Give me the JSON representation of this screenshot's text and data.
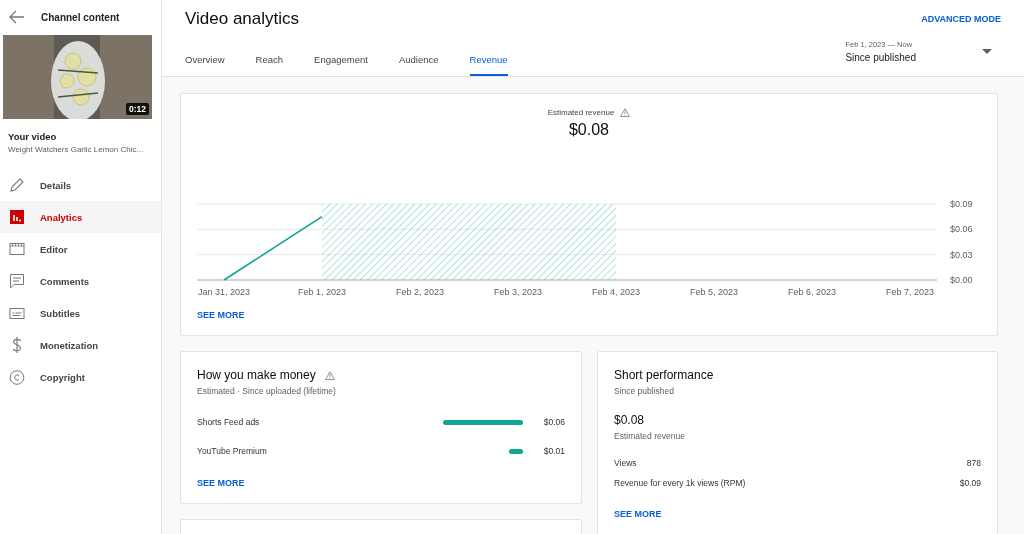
{
  "sidebar": {
    "back_label": "Channel content",
    "video": {
      "kind": "picture",
      "duration": "0:12",
      "heading": "Your video",
      "title": "Weight Watchers Garlic Lemon Chic..."
    },
    "items": [
      {
        "kind": "details",
        "label": "Details",
        "selected": false
      },
      {
        "kind": "analytics",
        "label": "Analytics",
        "selected": true
      },
      {
        "kind": "editor",
        "label": "Editor",
        "selected": false
      },
      {
        "kind": "comments",
        "label": "Comments",
        "selected": false
      },
      {
        "kind": "subtitles",
        "label": "Subtitles",
        "selected": false
      },
      {
        "kind": "monetization",
        "label": "Monetization",
        "selected": false
      },
      {
        "kind": "copyright",
        "label": "Copyright",
        "selected": false
      }
    ]
  },
  "header": {
    "title": "Video analytics",
    "advanced": "ADVANCED MODE",
    "tabs": [
      {
        "label": "Overview",
        "selected": false
      },
      {
        "label": "Reach",
        "selected": false
      },
      {
        "label": "Engagement",
        "selected": false
      },
      {
        "label": "Audience",
        "selected": false
      },
      {
        "label": "Revenue",
        "selected": true
      }
    ],
    "date_range": {
      "range": "Feb 1, 2023 — Now",
      "value": "Since published"
    }
  },
  "revenue_card": {
    "title": "Estimated revenue",
    "total": "$0.08",
    "see_more": "SEE MORE",
    "chart_data": {
      "type": "line",
      "categories": [
        "Jan 31, 2023",
        "Feb 1, 2023",
        "Feb 2, 2023",
        "Feb 3, 2023",
        "Feb 4, 2023",
        "Feb 5, 2023",
        "Feb 6, 2023",
        "Feb 7, 2023"
      ],
      "series": [
        {
          "color": "#12a594",
          "values": [
            0,
            0.075,
            null,
            null,
            null,
            null,
            null,
            null
          ]
        }
      ],
      "ylim": [
        0,
        0.09
      ],
      "yticks": [
        {
          "value": 0,
          "label": "$0.00"
        },
        {
          "value": 0.03,
          "label": "$0.03"
        },
        {
          "value": 0.06,
          "label": "$0.06"
        },
        {
          "value": 0.09,
          "label": "$0.09"
        }
      ]
    }
  },
  "money_card": {
    "title": "How you make money",
    "subtitle": "Estimated · Since uploaded (lifetime)",
    "see_more": "SEE MORE",
    "rows": [
      {
        "label": "Shorts Feed ads",
        "value": "$0.06"
      },
      {
        "label": "YouTube Premium",
        "value": "$0.01"
      }
    ]
  },
  "performance_card": {
    "title": "Short performance",
    "subtitle": "Since published",
    "total": "$0.08",
    "total_label": "Estimated revenue",
    "see_more": "SEE MORE",
    "rows": [
      {
        "label": "Views",
        "value": "878"
      },
      {
        "label": "Revenue for every 1k views (RPM)",
        "value": "$0.09"
      }
    ]
  }
}
